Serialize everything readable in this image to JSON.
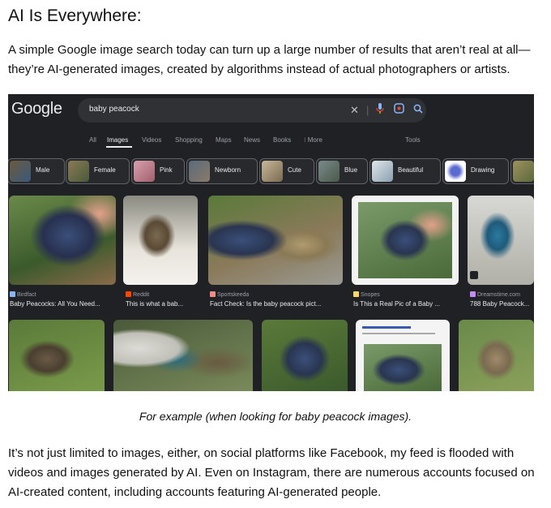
{
  "heading": "AI Is Everywhere:",
  "intro": "A simple Google image search today can turn up a large number of results that aren’t real at all—they’re AI-generated images, created by algorithms instead of actual photographers or artists.",
  "screenshot": {
    "logo": "Google",
    "search_value": "baby peacock",
    "icons": [
      "clear-icon",
      "mic-icon",
      "lens-icon",
      "search-icon"
    ],
    "tabs": [
      "All",
      "Images",
      "Videos",
      "Shopping",
      "Maps",
      "News",
      "Books",
      "⁝ More"
    ],
    "active_tab": "Images",
    "tools": "Tools",
    "chips": [
      "Male",
      "Female",
      "Pink",
      "Newborn",
      "Cute",
      "Blue",
      "Beautiful",
      "Drawing"
    ],
    "results": [
      {
        "source": "Birdfact",
        "title": "Baby Peacocks: All You Need..."
      },
      {
        "source": "Reddit",
        "title": "This is what a bab..."
      },
      {
        "source": "Sportskeeda",
        "title": "Fact Check: Is the baby peacock pict..."
      },
      {
        "source": "Snopes",
        "title": "Is This a Real Pic of a Baby ..."
      },
      {
        "source": "Dreamstime.com",
        "title": "788 Baby Peacock..."
      }
    ]
  },
  "figure_caption": "For example (when looking for baby peacock images).",
  "body": "It’s not just limited to images, either, on social platforms like Facebook, my feed is flooded with videos and images generated by AI. Even on Instagram, there are numerous accounts focused on AI-created content, including accounts featuring AI-generated people.",
  "colors": {
    "screenshot_bg": "#202124",
    "search_box": "#303134",
    "text_light": "#e8eaed",
    "text_muted": "#9aa0a6",
    "mic_blue": "#8ab4f8"
  }
}
